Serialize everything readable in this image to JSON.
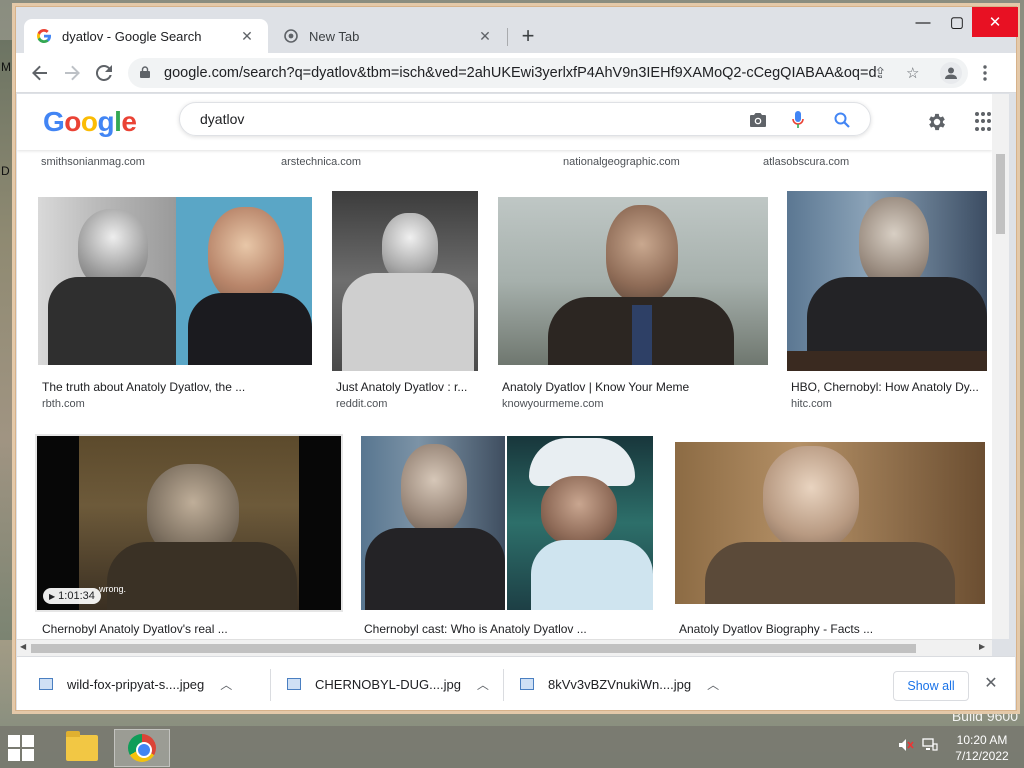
{
  "browser": {
    "tabs": [
      {
        "label": "dyatlov - Google Search",
        "favicon": "G",
        "active": true
      },
      {
        "label": "New Tab",
        "favicon": "chrome-icon",
        "active": false
      }
    ],
    "new_tab_symbol": "+",
    "url": "google.com/search?q=dyatlov&tbm=isch&ved=2ahUKEwi3yerlxfP4AhV9n3IEHf9XAMoQ2-cCegQIABAA&oq=d..."
  },
  "google": {
    "logo_letters": [
      "G",
      "o",
      "o",
      "g",
      "l",
      "e"
    ],
    "logo_colors": [
      "#4285f4",
      "#ea4335",
      "#fbbc05",
      "#4285f4",
      "#34a853",
      "#ea4335"
    ],
    "query": "dyatlov"
  },
  "top_sources": [
    "smithsonianmag.com",
    "arstechnica.com",
    "nationalgeographic.com",
    "atlasobscura.com"
  ],
  "results": [
    {
      "title": "The truth about Anatoly Dyatlov, the ...",
      "site": "rbth.com"
    },
    {
      "title": "Just Anatoly Dyatlov : r...",
      "site": "reddit.com"
    },
    {
      "title": "Anatoly Dyatlov | Know Your Meme",
      "site": "knowyourmeme.com"
    },
    {
      "title": "HBO, Chernobyl: How Anatoly Dy...",
      "site": "hitc.com"
    },
    {
      "title": "Chernobyl Anatoly Dyatlov's real ...",
      "site": "",
      "duration": "1:01:34",
      "overlay_text": "wrong."
    },
    {
      "title": "Chernobyl cast: Who is Anatoly Dyatlov ...",
      "site": ""
    },
    {
      "title": "Anatoly Dyatlov Biography - Facts ...",
      "site": ""
    }
  ],
  "downloads": {
    "items": [
      "wild-fox-pripyat-s....jpeg",
      "CHERNOBYL-DUG....jpg",
      "8kVv3vBZVnukiWn....jpg"
    ],
    "show_all": "Show all"
  },
  "taskbar": {
    "time": "10:20 AM",
    "date": "7/12/2022"
  },
  "desktop": {
    "build_text": "Build 9600"
  }
}
